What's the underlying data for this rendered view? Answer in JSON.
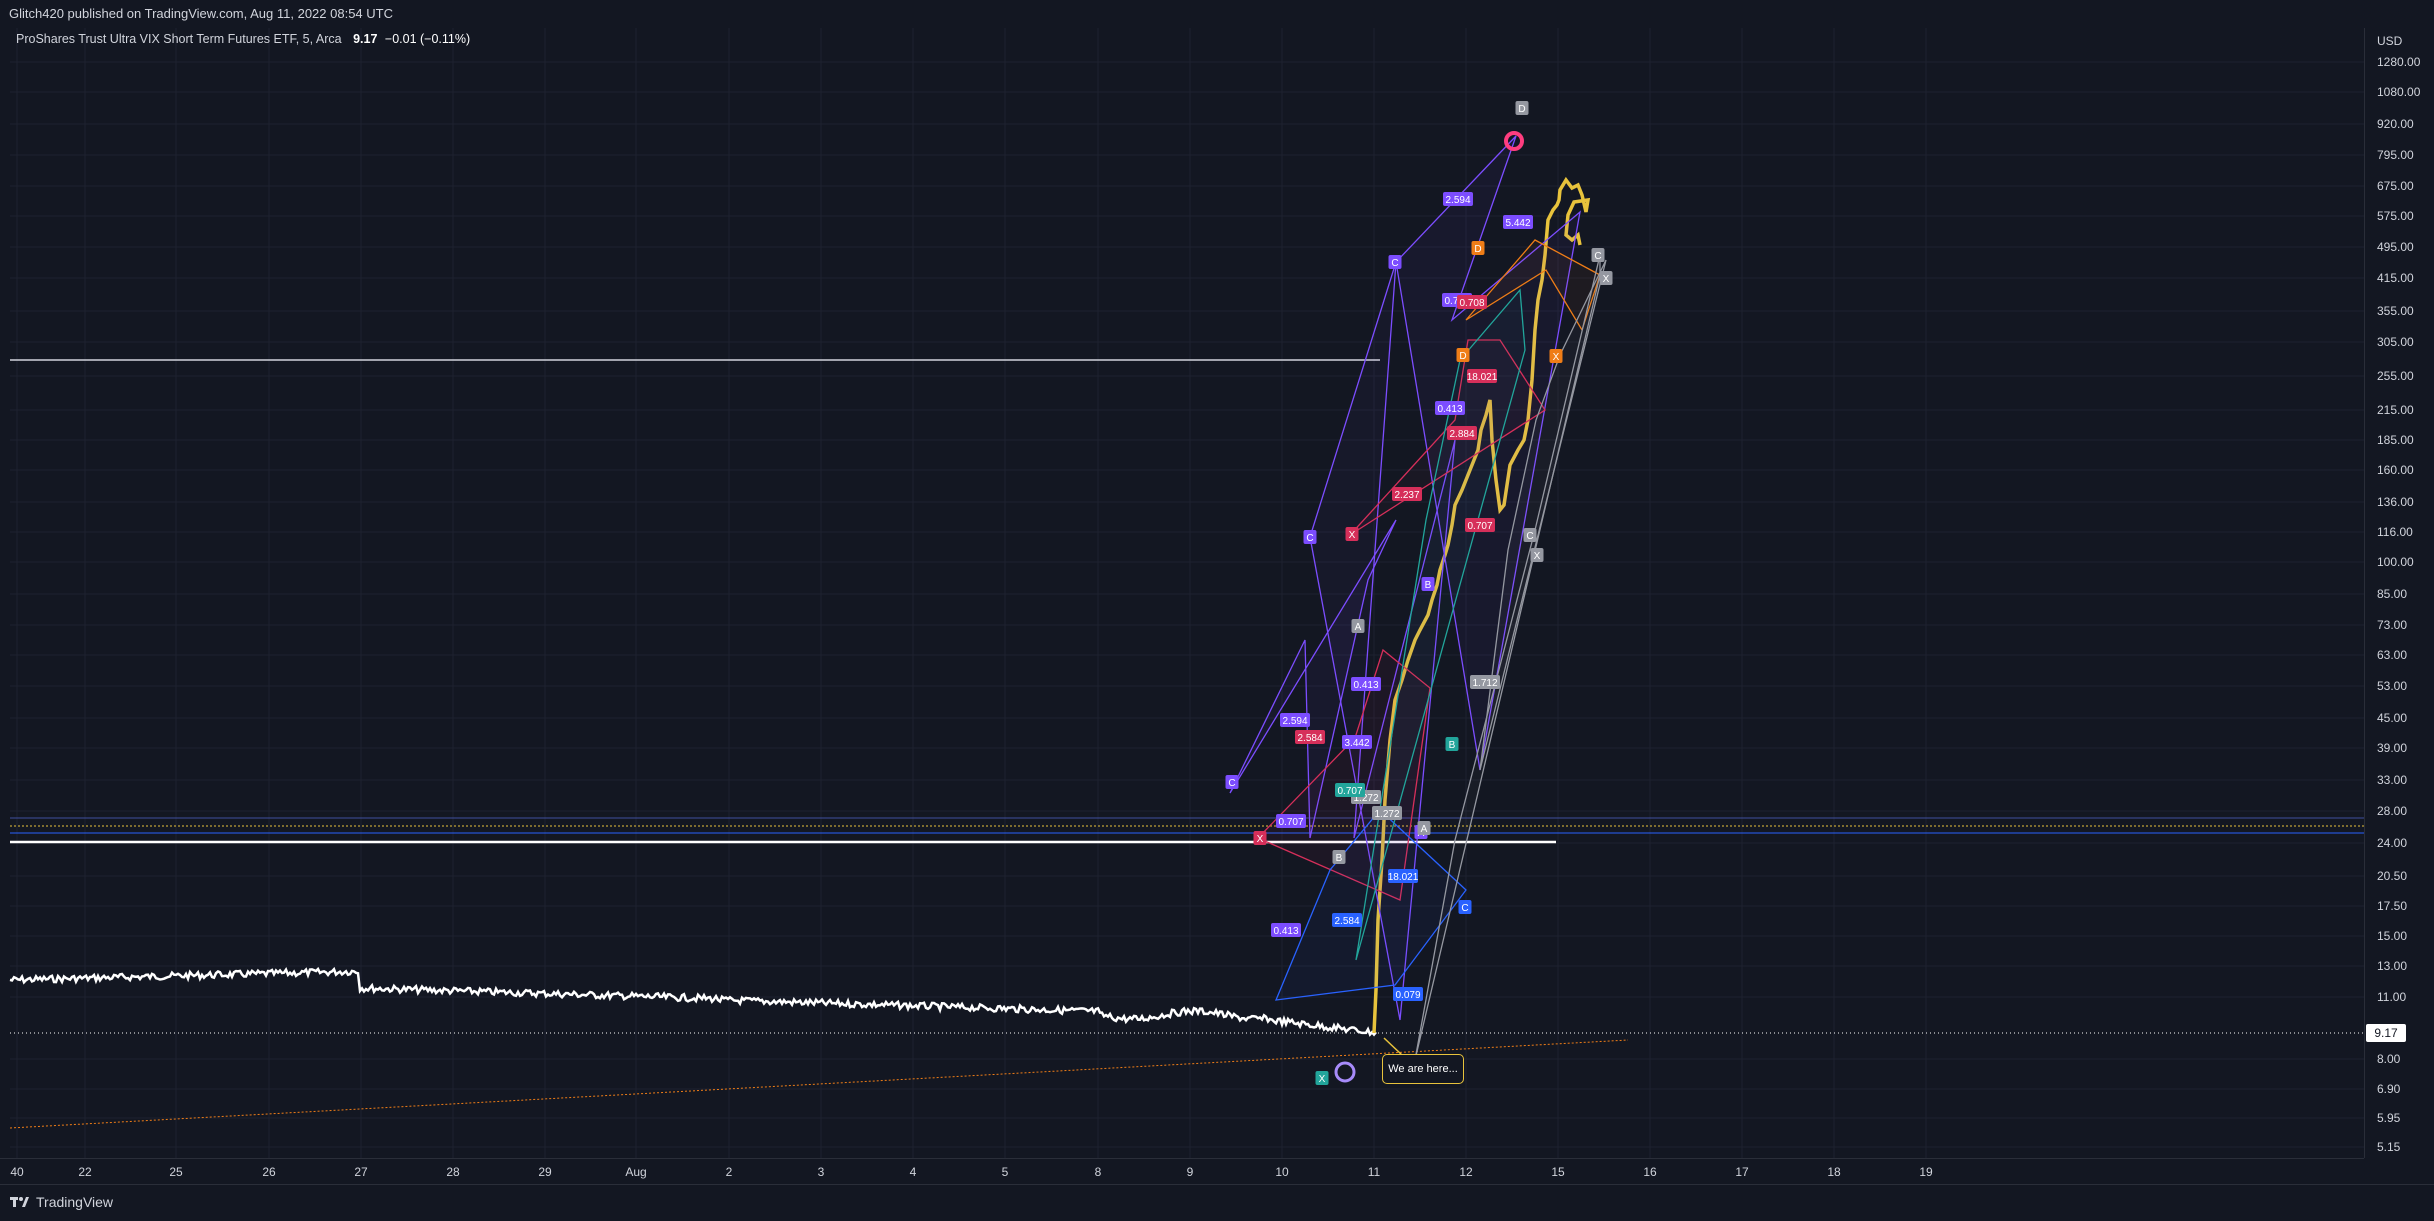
{
  "header": {
    "publisher_line": "Glitch420 published on TradingView.com, Aug 11, 2022 08:54 UTC"
  },
  "legend": {
    "symbol": "ProShares Trust Ultra VIX Short Term Futures ETF, 5, Arca",
    "price": "9.17",
    "change": "−0.01 (−0.11%)"
  },
  "price_axis": {
    "currency": "USD",
    "ticks": [
      "1280.00",
      "1080.00",
      "920.00",
      "795.00",
      "675.00",
      "575.00",
      "495.00",
      "415.00",
      "355.00",
      "305.00",
      "255.00",
      "215.00",
      "185.00",
      "160.00",
      "136.00",
      "116.00",
      "100.00",
      "85.00",
      "73.00",
      "63.00",
      "53.00",
      "45.00",
      "39.00",
      "33.00",
      "28.00",
      "24.00",
      "20.50",
      "17.50",
      "15.00",
      "13.00",
      "11.00",
      "8.00",
      "6.90",
      "5.95",
      "5.15"
    ],
    "last_price": "9.17"
  },
  "time_axis": {
    "ticks": [
      "40",
      "22",
      "25",
      "26",
      "27",
      "28",
      "29",
      "Aug",
      "2",
      "3",
      "4",
      "5",
      "8",
      "9",
      "10",
      "11",
      "12",
      "15",
      "16",
      "17",
      "18",
      "19"
    ]
  },
  "annotation": {
    "callout_text": "We are here..."
  },
  "footer": {
    "brand": "TradingView"
  },
  "colors": {
    "background": "#131722",
    "price_line": "#ffffff",
    "forecast_line": "#e8c33c",
    "harmonic_purple": "#7c4dff",
    "harmonic_red": "#d62f5a",
    "harmonic_teal": "#22a59b",
    "harmonic_blue": "#2962ff",
    "harmonic_orange": "#ef7d17",
    "harmonic_gray": "#9598a1"
  },
  "pattern_labels": [
    "2.594",
    "5.442",
    "0.707",
    "0.708",
    "18.021",
    "0.413",
    "2.884",
    "2.237",
    "0.707",
    "1.712",
    "0.413",
    "1.272",
    "2.594",
    "3.442",
    "2.584",
    "0.707",
    "1.272",
    "18.021",
    "0.413",
    "2.584",
    "0.707",
    "0.079",
    "C",
    "C",
    "C",
    "C",
    "C",
    "C",
    "X",
    "X",
    "X",
    "X",
    "X",
    "X",
    "A",
    "A",
    "A",
    "B",
    "B",
    "B",
    "D",
    "D",
    "D"
  ]
}
